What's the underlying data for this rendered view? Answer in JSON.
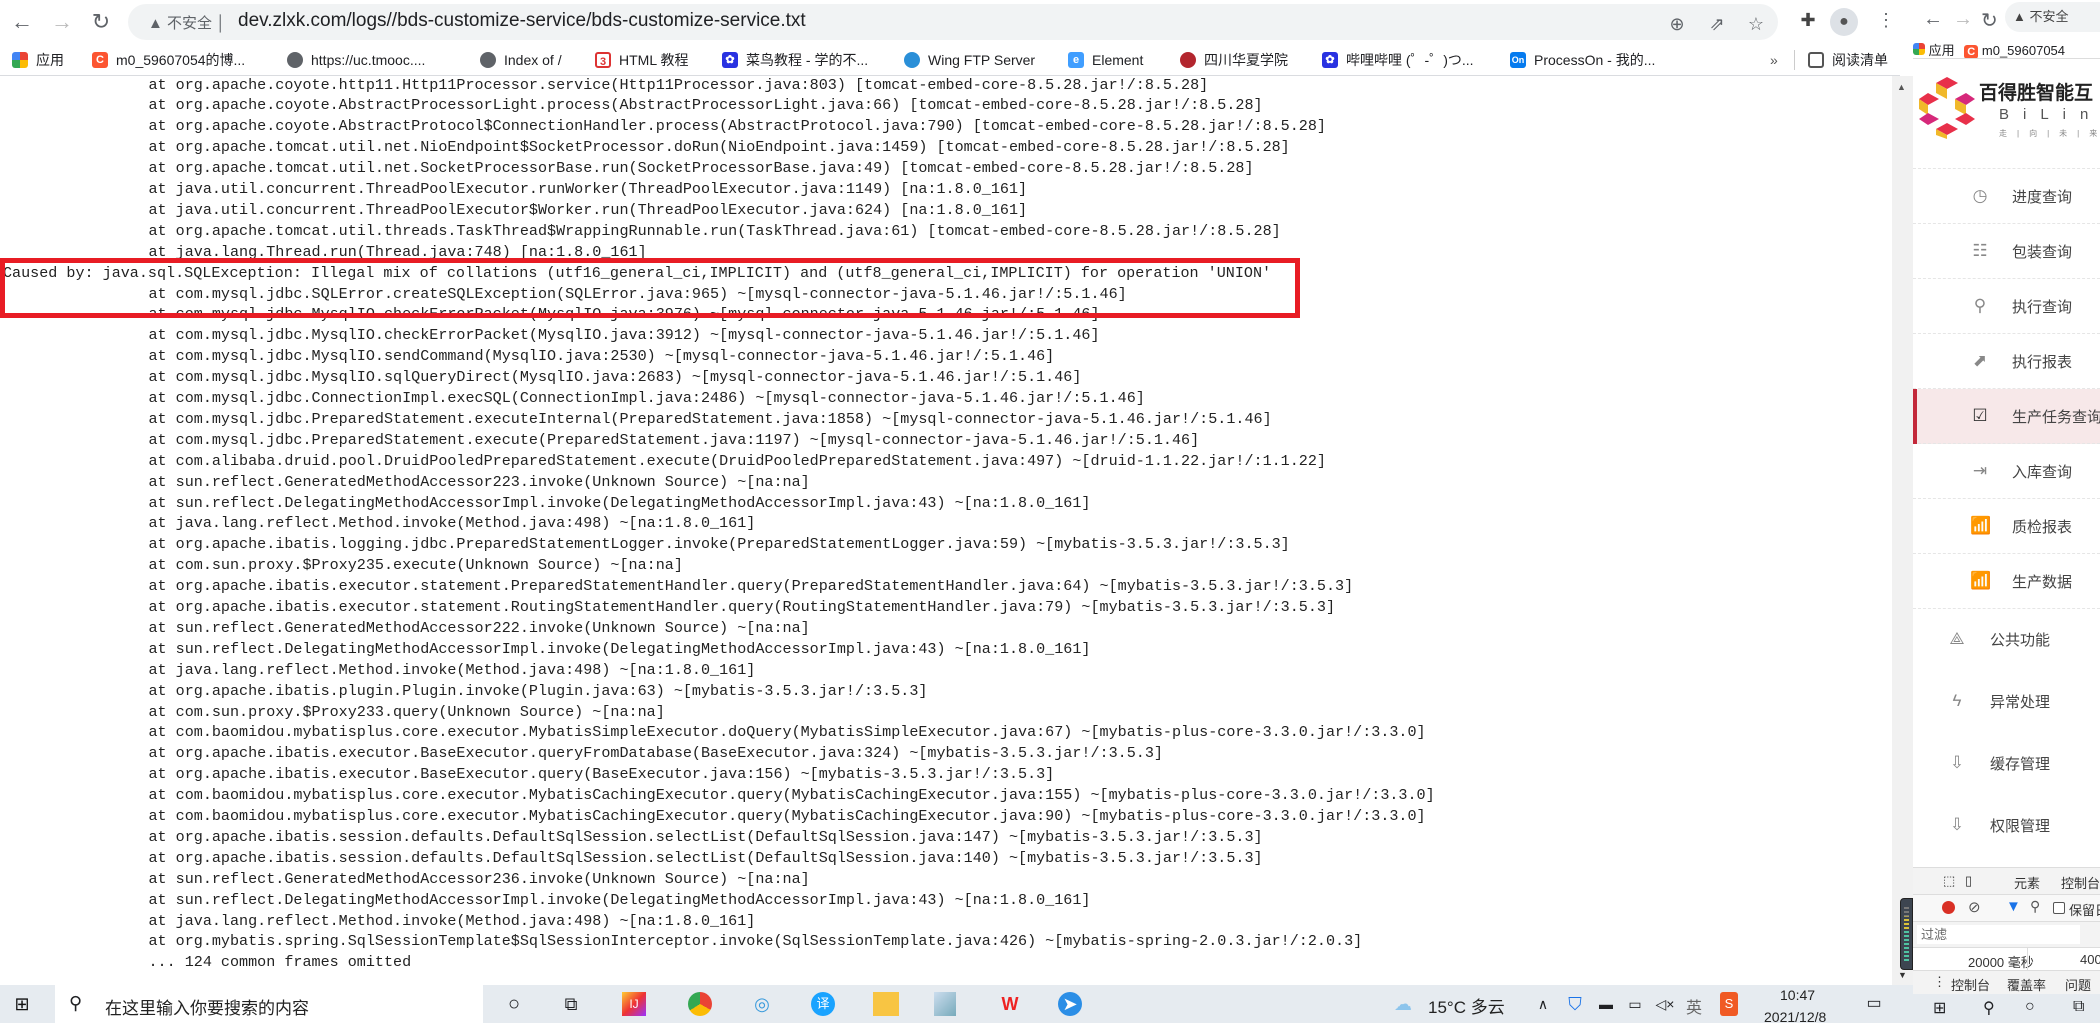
{
  "browser": {
    "security_label": "不安全",
    "url": "dev.zlxk.com/logs//bds-customize-service/bds-customize-service.txt",
    "bookmarks": [
      {
        "label": "应用",
        "icon": "apps-grid-icon"
      },
      {
        "label": "m0_59607054的博...",
        "icon": "csdn-icon"
      },
      {
        "label": "https://uc.tmooc....",
        "icon": "globe-icon"
      },
      {
        "label": "Index of /",
        "icon": "globe-icon"
      },
      {
        "label": "HTML 教程",
        "icon": "html-icon"
      },
      {
        "label": "菜鸟教程 - 学的不...",
        "icon": "baidu-paw-icon"
      },
      {
        "label": "Wing FTP Server",
        "icon": "wing-ftp-icon"
      },
      {
        "label": "Element",
        "icon": "element-icon"
      },
      {
        "label": "四川华夏学院",
        "icon": "school-icon"
      },
      {
        "label": "哔哩哔哩 (゜-゜)つ...",
        "icon": "baidu-paw-icon"
      },
      {
        "label": "ProcessOn - 我的...",
        "icon": "processon-icon"
      }
    ],
    "more_label": "»",
    "reading_list": "阅读清单"
  },
  "log": {
    "lines": [
      "\tat org.apache.coyote.http11.Http11Processor.service(Http11Processor.java:803) [tomcat-embed-core-8.5.28.jar!/:8.5.28]",
      "\tat org.apache.coyote.AbstractProcessorLight.process(AbstractProcessorLight.java:66) [tomcat-embed-core-8.5.28.jar!/:8.5.28]",
      "\tat org.apache.coyote.AbstractProtocol$ConnectionHandler.process(AbstractProtocol.java:790) [tomcat-embed-core-8.5.28.jar!/:8.5.28]",
      "\tat org.apache.tomcat.util.net.NioEndpoint$SocketProcessor.doRun(NioEndpoint.java:1459) [tomcat-embed-core-8.5.28.jar!/:8.5.28]",
      "\tat org.apache.tomcat.util.net.SocketProcessorBase.run(SocketProcessorBase.java:49) [tomcat-embed-core-8.5.28.jar!/:8.5.28]",
      "\tat java.util.concurrent.ThreadPoolExecutor.runWorker(ThreadPoolExecutor.java:1149) [na:1.8.0_161]",
      "\tat java.util.concurrent.ThreadPoolExecutor$Worker.run(ThreadPoolExecutor.java:624) [na:1.8.0_161]",
      "\tat org.apache.tomcat.util.threads.TaskThread$WrappingRunnable.run(TaskThread.java:61) [tomcat-embed-core-8.5.28.jar!/:8.5.28]",
      "\tat java.lang.Thread.run(Thread.java:748) [na:1.8.0_161]",
      "Caused by: java.sql.SQLException: Illegal mix of collations (utf16_general_ci,IMPLICIT) and (utf8_general_ci,IMPLICIT) for operation 'UNION'",
      "\tat com.mysql.jdbc.SQLError.createSQLException(SQLError.java:965) ~[mysql-connector-java-5.1.46.jar!/:5.1.46]",
      "\tat com.mysql.jdbc.MysqlIO.checkErrorPacket(MysqlIO.java:3976) ~[mysql-connector-java-5.1.46.jar!/:5.1.46]",
      "\tat com.mysql.jdbc.MysqlIO.checkErrorPacket(MysqlIO.java:3912) ~[mysql-connector-java-5.1.46.jar!/:5.1.46]",
      "\tat com.mysql.jdbc.MysqlIO.sendCommand(MysqlIO.java:2530) ~[mysql-connector-java-5.1.46.jar!/:5.1.46]",
      "\tat com.mysql.jdbc.MysqlIO.sqlQueryDirect(MysqlIO.java:2683) ~[mysql-connector-java-5.1.46.jar!/:5.1.46]",
      "\tat com.mysql.jdbc.ConnectionImpl.execSQL(ConnectionImpl.java:2486) ~[mysql-connector-java-5.1.46.jar!/:5.1.46]",
      "\tat com.mysql.jdbc.PreparedStatement.executeInternal(PreparedStatement.java:1858) ~[mysql-connector-java-5.1.46.jar!/:5.1.46]",
      "\tat com.mysql.jdbc.PreparedStatement.execute(PreparedStatement.java:1197) ~[mysql-connector-java-5.1.46.jar!/:5.1.46]",
      "\tat com.alibaba.druid.pool.DruidPooledPreparedStatement.execute(DruidPooledPreparedStatement.java:497) ~[druid-1.1.22.jar!/:1.1.22]",
      "\tat sun.reflect.GeneratedMethodAccessor223.invoke(Unknown Source) ~[na:na]",
      "\tat sun.reflect.DelegatingMethodAccessorImpl.invoke(DelegatingMethodAccessorImpl.java:43) ~[na:1.8.0_161]",
      "\tat java.lang.reflect.Method.invoke(Method.java:498) ~[na:1.8.0_161]",
      "\tat org.apache.ibatis.logging.jdbc.PreparedStatementLogger.invoke(PreparedStatementLogger.java:59) ~[mybatis-3.5.3.jar!/:3.5.3]",
      "\tat com.sun.proxy.$Proxy235.execute(Unknown Source) ~[na:na]",
      "\tat org.apache.ibatis.executor.statement.PreparedStatementHandler.query(PreparedStatementHandler.java:64) ~[mybatis-3.5.3.jar!/:3.5.3]",
      "\tat org.apache.ibatis.executor.statement.RoutingStatementHandler.query(RoutingStatementHandler.java:79) ~[mybatis-3.5.3.jar!/:3.5.3]",
      "\tat sun.reflect.GeneratedMethodAccessor222.invoke(Unknown Source) ~[na:na]",
      "\tat sun.reflect.DelegatingMethodAccessorImpl.invoke(DelegatingMethodAccessorImpl.java:43) ~[na:1.8.0_161]",
      "\tat java.lang.reflect.Method.invoke(Method.java:498) ~[na:1.8.0_161]",
      "\tat org.apache.ibatis.plugin.Plugin.invoke(Plugin.java:63) ~[mybatis-3.5.3.jar!/:3.5.3]",
      "\tat com.sun.proxy.$Proxy233.query(Unknown Source) ~[na:na]",
      "\tat com.baomidou.mybatisplus.core.executor.MybatisSimpleExecutor.doQuery(MybatisSimpleExecutor.java:67) ~[mybatis-plus-core-3.3.0.jar!/:3.3.0]",
      "\tat org.apache.ibatis.executor.BaseExecutor.queryFromDatabase(BaseExecutor.java:324) ~[mybatis-3.5.3.jar!/:3.5.3]",
      "\tat org.apache.ibatis.executor.BaseExecutor.query(BaseExecutor.java:156) ~[mybatis-3.5.3.jar!/:3.5.3]",
      "\tat com.baomidou.mybatisplus.core.executor.MybatisCachingExecutor.query(MybatisCachingExecutor.java:155) ~[mybatis-plus-core-3.3.0.jar!/:3.3.0]",
      "\tat com.baomidou.mybatisplus.core.executor.MybatisCachingExecutor.query(MybatisCachingExecutor.java:90) ~[mybatis-plus-core-3.3.0.jar!/:3.3.0]",
      "\tat org.apache.ibatis.session.defaults.DefaultSqlSession.selectList(DefaultSqlSession.java:147) ~[mybatis-3.5.3.jar!/:3.5.3]",
      "\tat org.apache.ibatis.session.defaults.DefaultSqlSession.selectList(DefaultSqlSession.java:140) ~[mybatis-3.5.3.jar!/:3.5.3]",
      "\tat sun.reflect.GeneratedMethodAccessor236.invoke(Unknown Source) ~[na:na]",
      "\tat sun.reflect.DelegatingMethodAccessorImpl.invoke(DelegatingMethodAccessorImpl.java:43) ~[na:1.8.0_161]",
      "\tat java.lang.reflect.Method.invoke(Method.java:498) ~[na:1.8.0_161]",
      "\tat org.mybatis.spring.SqlSessionTemplate$SqlSessionInterceptor.invoke(SqlSessionTemplate.java:426) ~[mybatis-spring-2.0.3.jar!/:2.0.3]",
      "\t... 124 common frames omitted"
    ],
    "highlight_color": "#e81c24"
  },
  "right_window": {
    "security_label": "不安全",
    "bookmarks": [
      {
        "label": "应用"
      },
      {
        "label": "m0_59607054"
      }
    ],
    "brand": {
      "name": "百得胜智能互",
      "latin": "BiLink",
      "slogan": "走|向|未|来"
    },
    "menu": [
      {
        "label": "进度查询",
        "icon": "clock-refresh-icon"
      },
      {
        "label": "包装查询",
        "icon": "layout-icon"
      },
      {
        "label": "执行查询",
        "icon": "list-search-icon"
      },
      {
        "label": "执行报表",
        "icon": "trend-chart-icon"
      },
      {
        "label": "生产任务查询",
        "icon": "calendar-check-icon",
        "active": true
      },
      {
        "label": "入库查询",
        "icon": "inbox-arrow-icon"
      },
      {
        "label": "质检报表",
        "icon": "bar-chart-icon"
      },
      {
        "label": "生产数据",
        "icon": "bar-chart-icon"
      }
    ],
    "groups": [
      {
        "label": "公共功能",
        "icon": "nodes-icon"
      },
      {
        "label": "异常处理",
        "icon": "alarm-icon"
      },
      {
        "label": "缓存管理",
        "icon": "folder-download-icon"
      },
      {
        "label": "权限管理",
        "icon": "folder-download-icon"
      }
    ],
    "accent": "#c3283a",
    "devtools": {
      "tabs": [
        "元素",
        "控制台"
      ],
      "preserve_log": "保留日",
      "filter_placeholder": "过滤",
      "timing": "20000 毫秒",
      "timing2": "400",
      "drawer_tabs": [
        "控制台",
        "覆盖率",
        "问题"
      ]
    }
  },
  "taskbar": {
    "search_placeholder": "在这里输入你要搜索的内容",
    "weather": "15°C 多云",
    "ime": "英",
    "time": "10:47",
    "date": "2021/12/8"
  }
}
